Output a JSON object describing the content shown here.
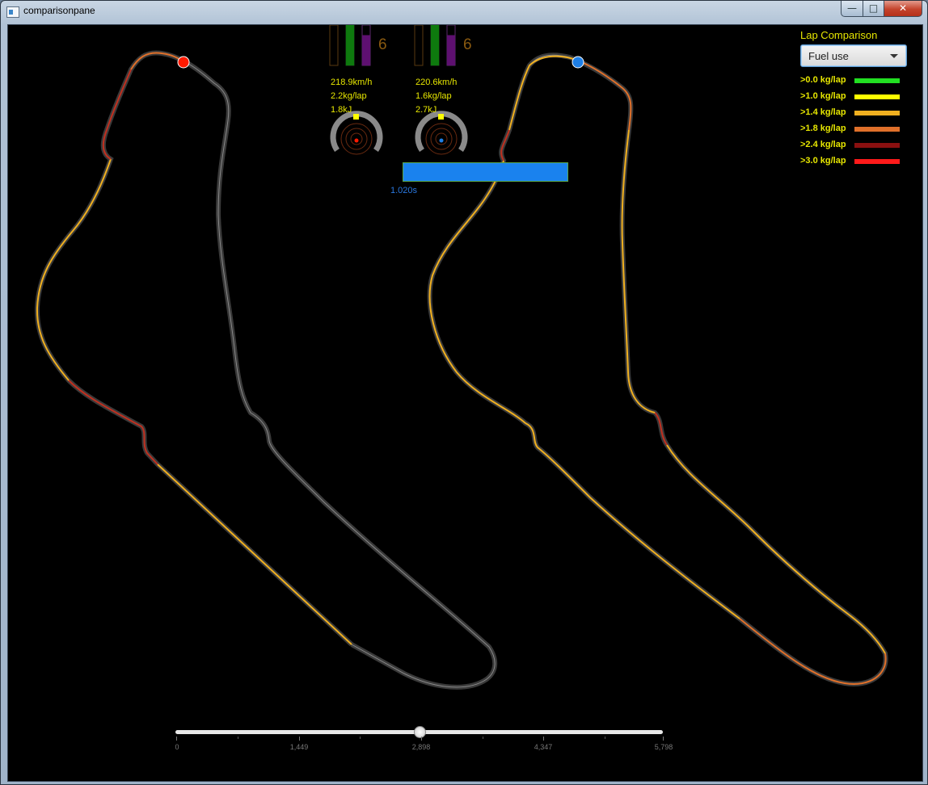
{
  "window": {
    "title": "comparisonpane",
    "minimize_glyph": "—",
    "maximize_glyph": "□",
    "close_glyph": "✕"
  },
  "car_a": {
    "gear": "6",
    "speed": "218.9km/h",
    "fuel": "2.2kg/lap",
    "energy": "1.8kJ",
    "marker_color": "#ff1a00",
    "throttle_level": 1.0,
    "brake_level": 0.0,
    "ers_level": 0.75
  },
  "car_b": {
    "gear": "6",
    "speed": "220.6km/h",
    "fuel": "1.6kg/lap",
    "energy": "2.7kJ",
    "marker_color": "#1e7fe6",
    "throttle_level": 1.0,
    "brake_level": 0.0,
    "ers_level": 0.75
  },
  "delta": {
    "label": "1.020s"
  },
  "lap_comparison": {
    "title": "Lap Comparison",
    "metric": "Fuel use",
    "legend": [
      {
        "label": ">0.0 kg/lap",
        "color": "#22e022"
      },
      {
        "label": ">1.0 kg/lap",
        "color": "#ffff00"
      },
      {
        "label": ">1.4 kg/lap",
        "color": "#f0b020"
      },
      {
        "label": ">1.8 kg/lap",
        "color": "#e0702a"
      },
      {
        "label": ">2.4 kg/lap",
        "color": "#8a1010"
      },
      {
        "label": ">3.0 kg/lap",
        "color": "#ff1a1a"
      }
    ]
  },
  "distance_slider": {
    "value_fraction": 0.5,
    "ticks": [
      "0",
      "1,449",
      "2,898",
      "4,347",
      "5,798"
    ]
  }
}
